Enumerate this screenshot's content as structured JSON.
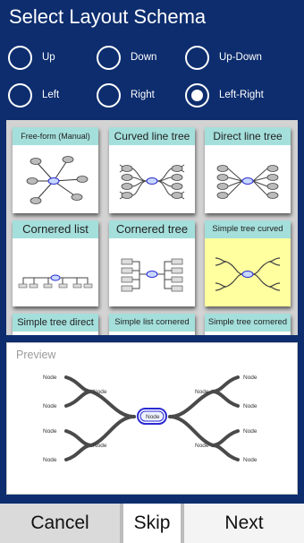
{
  "dialog": {
    "title": "Select Layout Schema"
  },
  "radios": [
    {
      "label": "Up",
      "selected": false
    },
    {
      "label": "Down",
      "selected": false
    },
    {
      "label": "Up-Down",
      "selected": false
    },
    {
      "label": "Left",
      "selected": false
    },
    {
      "label": "Right",
      "selected": false
    },
    {
      "label": "Left-Right",
      "selected": true
    }
  ],
  "layouts": [
    {
      "label": "Free-form (Manual)",
      "selected": false
    },
    {
      "label": "Curved line tree",
      "selected": false
    },
    {
      "label": "Direct line tree",
      "selected": false
    },
    {
      "label": "Cornered list",
      "selected": false
    },
    {
      "label": "Cornered tree",
      "selected": false
    },
    {
      "label": "Simple tree curved",
      "selected": true
    },
    {
      "label": "Simple tree direct",
      "selected": false
    },
    {
      "label": "Simple list cornered",
      "selected": false
    },
    {
      "label": "Simple tree cornered",
      "selected": false
    }
  ],
  "preview": {
    "label": "Preview",
    "root": "Node",
    "node": "Node"
  },
  "buttons": {
    "cancel": "Cancel",
    "skip": "Skip",
    "next": "Next"
  },
  "colors": {
    "background": "#0d2d6e",
    "caption": "#a4dfdb",
    "selected_card": "#ffff9f",
    "root_stroke": "#2a2ad4",
    "branch": "#4a4a4a"
  }
}
